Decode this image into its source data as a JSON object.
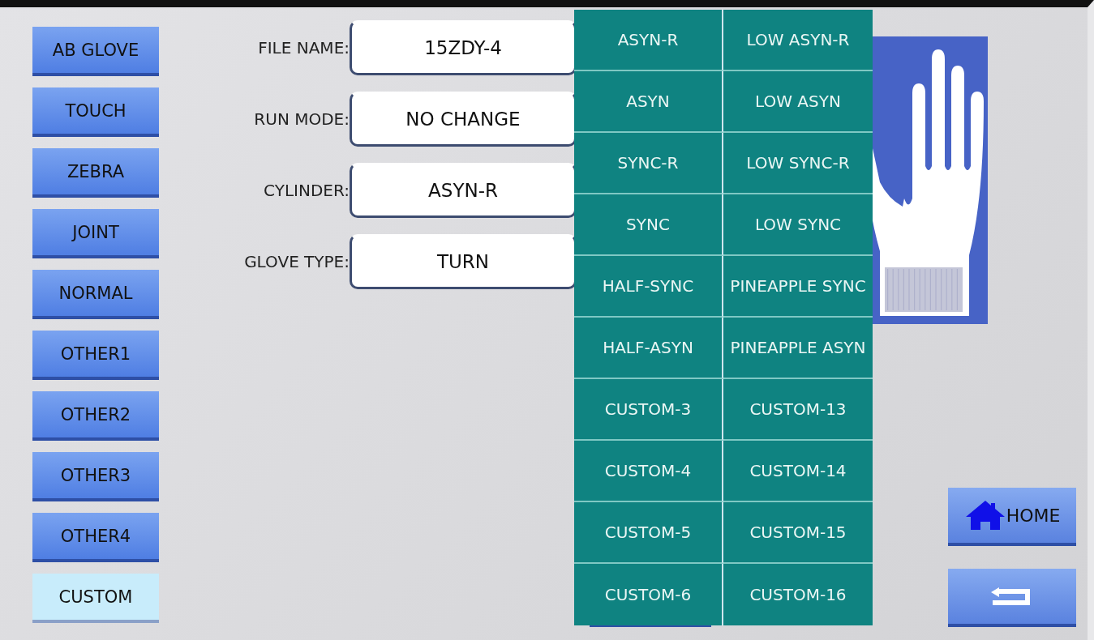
{
  "sidebar": {
    "items": [
      {
        "label": "AB GLOVE",
        "selected": false
      },
      {
        "label": "TOUCH",
        "selected": false
      },
      {
        "label": "ZEBRA",
        "selected": false
      },
      {
        "label": "JOINT",
        "selected": false
      },
      {
        "label": "NORMAL",
        "selected": false
      },
      {
        "label": "OTHER1",
        "selected": false
      },
      {
        "label": "OTHER2",
        "selected": false
      },
      {
        "label": "OTHER3",
        "selected": false
      },
      {
        "label": "OTHER4",
        "selected": false
      },
      {
        "label": "CUSTOM",
        "selected": true
      }
    ]
  },
  "fields": [
    {
      "label": "FILE NAME:",
      "value": "15ZDY-4"
    },
    {
      "label": "RUN MODE:",
      "value": "NO CHANGE"
    },
    {
      "label": "CYLINDER:",
      "value": "ASYN-R"
    },
    {
      "label": "GLOVE TYPE:",
      "value": "TURN"
    }
  ],
  "menu": {
    "items": [
      "ASYN-R",
      "LOW ASYN-R",
      "ASYN",
      "LOW ASYN",
      "SYNC-R",
      "LOW SYNC-R",
      "SYNC",
      "LOW SYNC",
      "HALF-SYNC",
      "PINEAPPLE SYNC",
      "HALF-ASYN",
      "PINEAPPLE ASYN",
      "CUSTOM-3",
      "CUSTOM-13",
      "CUSTOM-4",
      "CUSTOM-14",
      "CUSTOM-5",
      "CUSTOM-15",
      "CUSTOM-6",
      "CUSTOM-16"
    ]
  },
  "buttons": [
    {
      "kind": "home",
      "label": "HOME"
    },
    {
      "kind": "back"
    }
  ]
}
